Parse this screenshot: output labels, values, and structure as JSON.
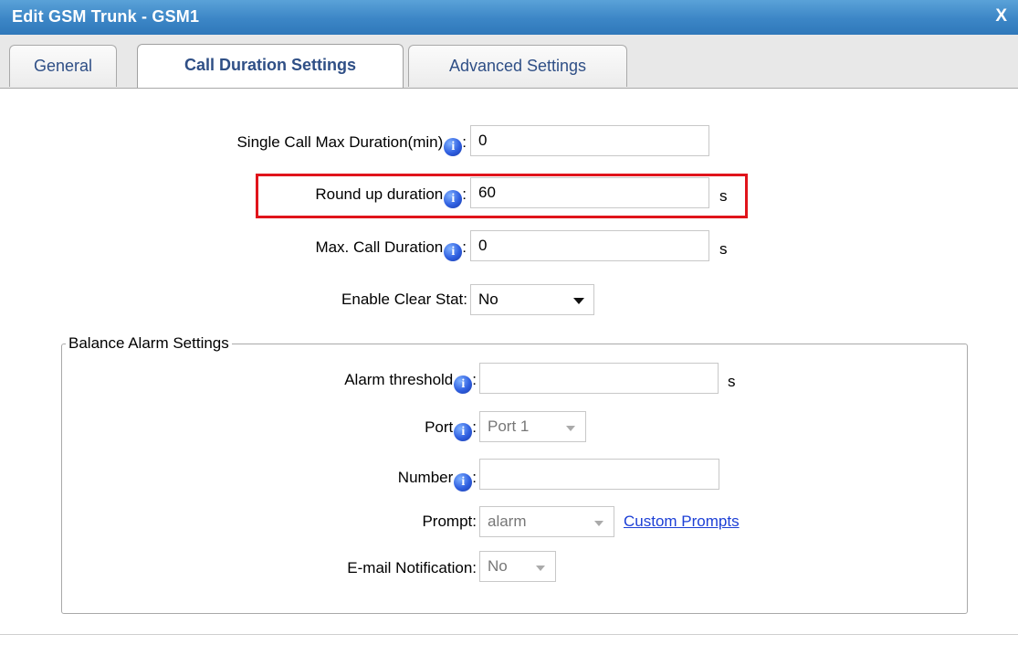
{
  "window": {
    "title": "Edit GSM Trunk - GSM1",
    "close": "X"
  },
  "tabs": [
    "General",
    "Call Duration Settings",
    "Advanced Settings"
  ],
  "fields": {
    "single_call_max": {
      "label": "Single Call Max Duration(min)",
      "value": "0"
    },
    "round_up": {
      "label": "Round up duration",
      "value": "60",
      "unit": "s"
    },
    "max_call": {
      "label": "Max. Call Duration",
      "value": "0",
      "unit": "s"
    },
    "clear_stat": {
      "label": "Enable Clear Stat:",
      "value": "No"
    }
  },
  "balance": {
    "legend": "Balance Alarm Settings",
    "alarm_threshold": {
      "label": "Alarm threshold",
      "value": "",
      "unit": "s"
    },
    "port": {
      "label": "Port",
      "value": "Port 1"
    },
    "number": {
      "label": "Number",
      "value": ""
    },
    "prompt": {
      "label": "Prompt:",
      "value": "alarm",
      "link": "Custom Prompts"
    },
    "email": {
      "label": "E-mail Notification:",
      "value": "No"
    }
  },
  "icons": {
    "info": "info-icon",
    "info_glyph": "i"
  },
  "colors": {
    "titlebar": "#3c86c6",
    "highlight": "#e0141b",
    "link": "#1c3fd6"
  }
}
